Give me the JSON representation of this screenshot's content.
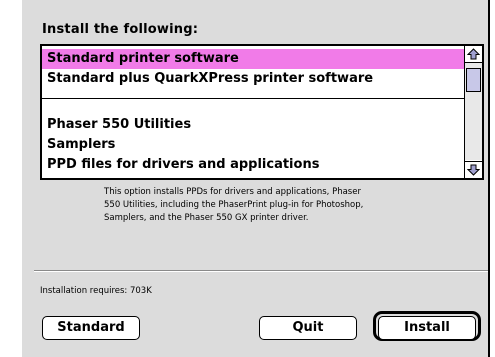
{
  "dialog": {
    "heading": "Install the following:",
    "options": [
      {
        "label": "Standard printer software",
        "selected": true
      },
      {
        "label": "Standard plus QuarkXPress printer software",
        "selected": false
      },
      {
        "label": "Phaser 550 Utilities",
        "selected": false
      },
      {
        "label": "Samplers",
        "selected": false
      },
      {
        "label": "PPD files for drivers and applications",
        "selected": false
      }
    ],
    "description": [
      "This option installs PPDs for drivers and applications, Phaser",
      "550 Utilities, including the PhaserPrint plug-in for Photoshop,",
      "Samplers, and the Phaser 550 GX printer driver."
    ],
    "requires": "Installation requires: 703K",
    "buttons": {
      "standard": "Standard",
      "quit": "Quit",
      "install": "Install"
    },
    "colors": {
      "selection": "#f17be8",
      "background": "#dcdcdc"
    },
    "icons": {
      "scroll_up": "scroll-up-arrow-icon",
      "scroll_down": "scroll-down-arrow-icon"
    }
  }
}
